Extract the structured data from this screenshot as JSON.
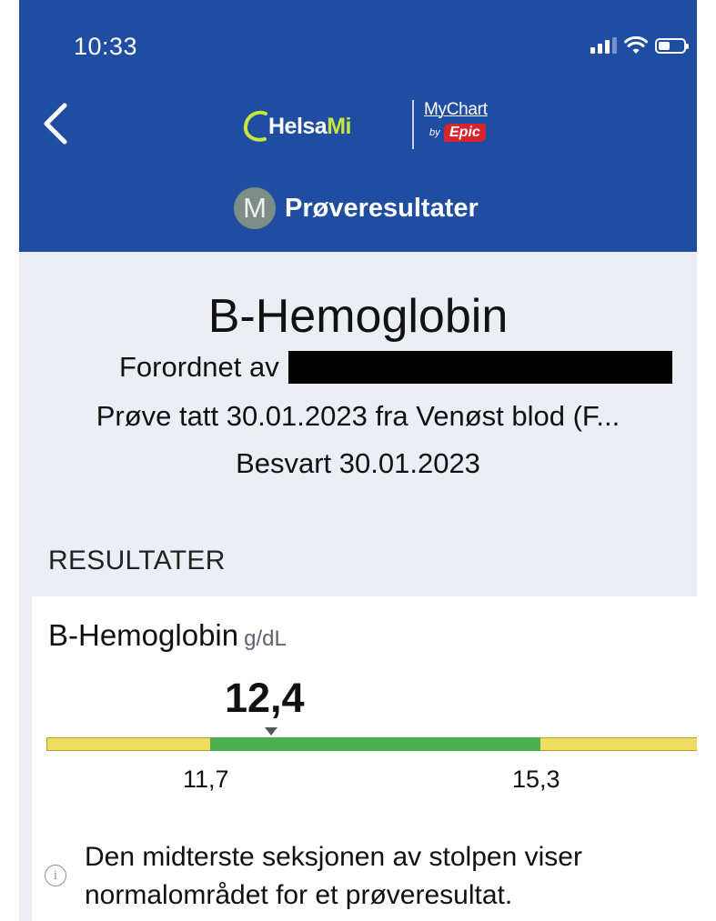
{
  "status_bar": {
    "time": "10:33",
    "icons": [
      "cellular-signal-icon",
      "wifi-icon",
      "battery-icon"
    ]
  },
  "header": {
    "back_icon": "chevron-left-icon",
    "logo_helsa": "Helsa",
    "logo_mi": "Mi",
    "logo_mychart": "MyChart",
    "logo_by": "by",
    "logo_epic": "Epic",
    "avatar_initial": "M",
    "section_title": "Prøveresultater",
    "background_color": "#1f4da1"
  },
  "test": {
    "title": "B-Hemoglobin",
    "ordered_by_label": "Forordnet av",
    "sample_taken": "Prøve tatt 30.01.2023 fra Venøst blod (F...",
    "answered": "Besvart 30.01.2023"
  },
  "results": {
    "heading": "RESULTATER",
    "items": [
      {
        "name": "B-Hemoglobin",
        "unit": "g/dL",
        "value": "12,4",
        "range_low": "11,7",
        "range_high": "15,3",
        "normal_color": "#4caf50",
        "outside_color": "#f0dc60"
      }
    ],
    "info_icon": "info-circle-icon",
    "info_text": "Den midterste seksjonen av stolpen viser normalområdet for et prøveresultat."
  }
}
